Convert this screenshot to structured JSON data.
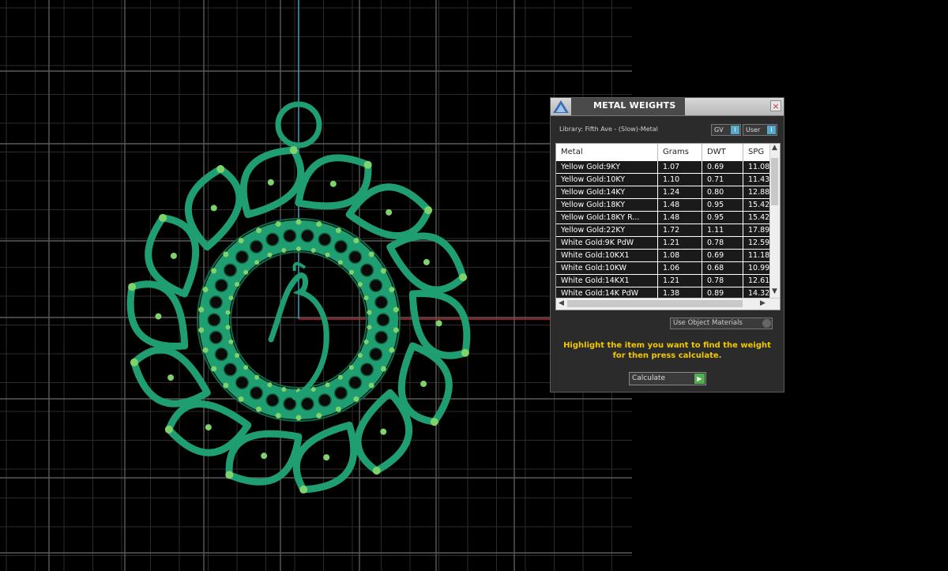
{
  "window": {
    "title": "METAL WEIGHTS",
    "close_label": "×"
  },
  "library": {
    "label": "Library: Fifth Ave - (Slow)-Metal"
  },
  "toggles": {
    "gv_label": "GV",
    "user_label": "User",
    "switch_glyph": "I"
  },
  "table": {
    "columns": [
      "Metal",
      "Grams",
      "DWT",
      "SPG"
    ],
    "rows": [
      [
        "Yellow Gold:9KY",
        "1.07",
        "0.69",
        "11.08"
      ],
      [
        "Yellow Gold:10KY",
        "1.10",
        "0.71",
        "11.43"
      ],
      [
        "Yellow Gold:14KY",
        "1.24",
        "0.80",
        "12.88"
      ],
      [
        "Yellow Gold:18KY",
        "1.48",
        "0.95",
        "15.42"
      ],
      [
        "Yellow Gold:18KY R...",
        "1.48",
        "0.95",
        "15.42"
      ],
      [
        "Yellow Gold:22KY",
        "1.72",
        "1.11",
        "17.89"
      ],
      [
        "White Gold:9K PdW",
        "1.21",
        "0.78",
        "12.59"
      ],
      [
        "White Gold:10KX1",
        "1.08",
        "0.69",
        "11.18"
      ],
      [
        "White Gold:10KW",
        "1.06",
        "0.68",
        "10.99"
      ],
      [
        "White Gold:14KX1",
        "1.21",
        "0.78",
        "12.61"
      ],
      [
        "White Gold:14K PdW",
        "1.38",
        "0.89",
        "14.32"
      ]
    ]
  },
  "use_object_materials": {
    "label": "Use Object Materials"
  },
  "hint": {
    "line1": "Highlight the item you want to find the weight",
    "line2": "for then press calculate."
  },
  "calculate": {
    "label": "Calculate",
    "go_glyph": "▶"
  },
  "colors": {
    "pendant": "#1f9e72",
    "pendant_edge": "#0f6a4a",
    "gem": "#7ed36a",
    "grid": "#5a5a5a",
    "axis_red": "#c0282a",
    "axis_blue": "#3aa0c0",
    "hint": "#f0c800"
  }
}
